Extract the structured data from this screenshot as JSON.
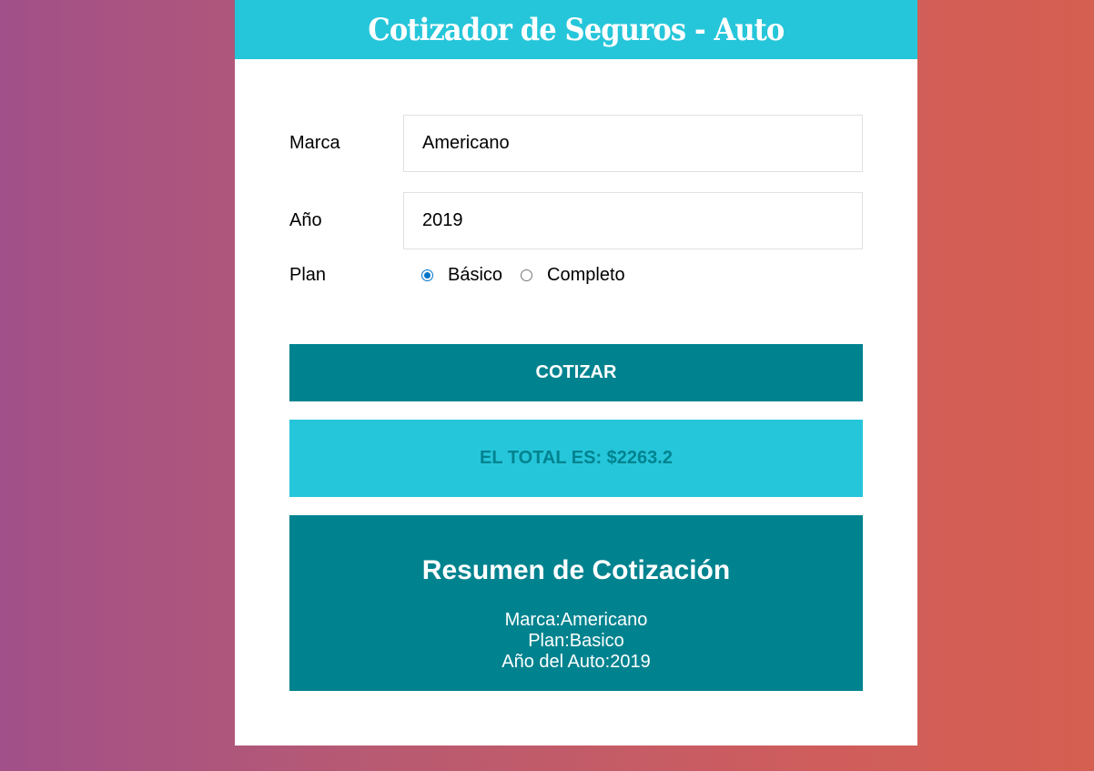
{
  "header": {
    "title": "Cotizador de Seguros - Auto"
  },
  "form": {
    "marca": {
      "label": "Marca",
      "value": "Americano"
    },
    "anio": {
      "label": "Año",
      "value": "2019"
    },
    "plan": {
      "label": "Plan",
      "options": [
        {
          "label": "Básico",
          "checked": true
        },
        {
          "label": "Completo",
          "checked": false
        }
      ]
    }
  },
  "button": {
    "label": "COTIZAR"
  },
  "total": {
    "text": "EL TOTAL ES: $2263.2"
  },
  "summary": {
    "title": "Resumen de Cotización",
    "lines": [
      "Marca:Americano",
      "Plan:Basico",
      "Año del Auto:2019"
    ]
  },
  "colors": {
    "header": "#26c6da",
    "button": "#00838f",
    "total_bg": "#26c6da",
    "total_text": "#00838f",
    "summary_bg": "#00838f"
  }
}
